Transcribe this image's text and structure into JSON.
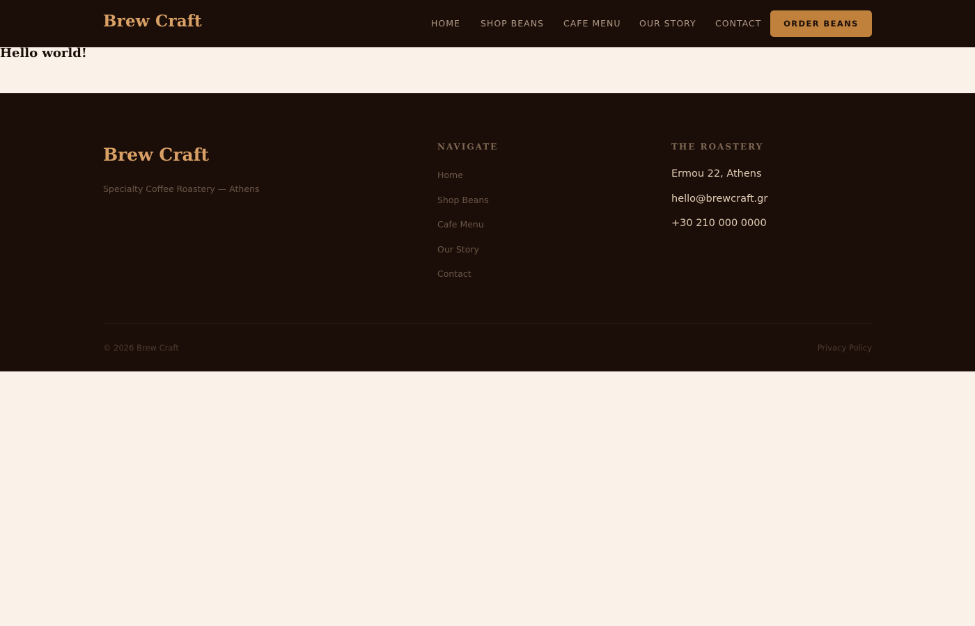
{
  "header": {
    "brand": "Brew Craft",
    "nav": [
      "HOME",
      "SHOP BEANS",
      "CAFE MENU",
      "OUR STORY",
      "CONTACT"
    ],
    "cta": "ORDER BEANS"
  },
  "main": {
    "heading": "Hello world!"
  },
  "footer": {
    "brand": "Brew Craft",
    "tagline": "Specialty Coffee Roastery — Athens",
    "navigate_heading": "NAVIGATE",
    "navigate_links": [
      "Home",
      "Shop Beans",
      "Cafe Menu",
      "Our Story",
      "Contact"
    ],
    "roastery_heading": "THE ROASTERY",
    "address": "Ermou 22, Athens",
    "email": "hello@brewcraft.gr",
    "phone": "+30 210 000 0000",
    "copyright": "© 2026 Brew Craft",
    "privacy": "Privacy Policy"
  },
  "colors": {
    "dark_background": "#1b0e08",
    "page_background": "#faf2e9",
    "brand_accent": "#d9a066",
    "button": "#c0813d"
  }
}
